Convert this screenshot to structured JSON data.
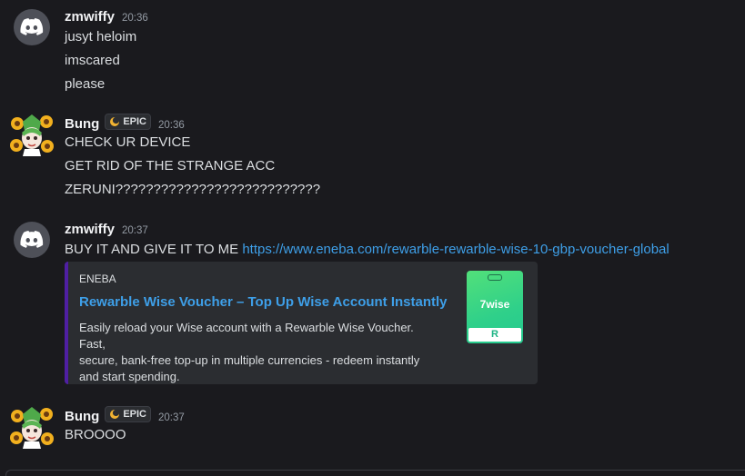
{
  "messages": [
    {
      "username": "zmwiffy",
      "time": "20:36",
      "avatar_icon": "discord-logo-icon",
      "lines": [
        "jusyt heloim",
        "imscared",
        "please"
      ]
    },
    {
      "username": "Bung",
      "time": "20:36",
      "tag": "EPIC",
      "avatar_icon": "anime-sunflower-avatar",
      "lines": [
        "CHECK UR DEVICE",
        "GET RID OF THE STRANGE ACC",
        "ZERUNI???????????????????????????"
      ]
    },
    {
      "username": "zmwiffy",
      "time": "20:37",
      "avatar_icon": "discord-logo-icon",
      "text": "BUY IT AND GIVE IT TO ME",
      "link": "https://www.eneba.com/rewarble-rewarble-wise-10-gbp-voucher-global",
      "embed": {
        "provider": "ENEBA",
        "title": "Rewarble Wise Voucher – Top Up Wise Account Instantly",
        "description": [
          "Easily reload your Wise account with a Rewarble Wise Voucher. Fast,",
          "secure, bank-free top-up in multiple currencies - redeem instantly",
          "and start spending."
        ],
        "thumbnail_text": "7wise",
        "thumbnail_badge": "R",
        "accent_color": "#4f1fa3"
      }
    },
    {
      "username": "Bung",
      "time": "20:37",
      "tag": "EPIC",
      "avatar_icon": "anime-sunflower-avatar",
      "lines": [
        "BROOOO"
      ]
    }
  ],
  "colors": {
    "background": "#1a1a1e",
    "link": "#3e9fe8",
    "timestamp": "#949ba4",
    "embed_bg": "#2b2d31"
  }
}
